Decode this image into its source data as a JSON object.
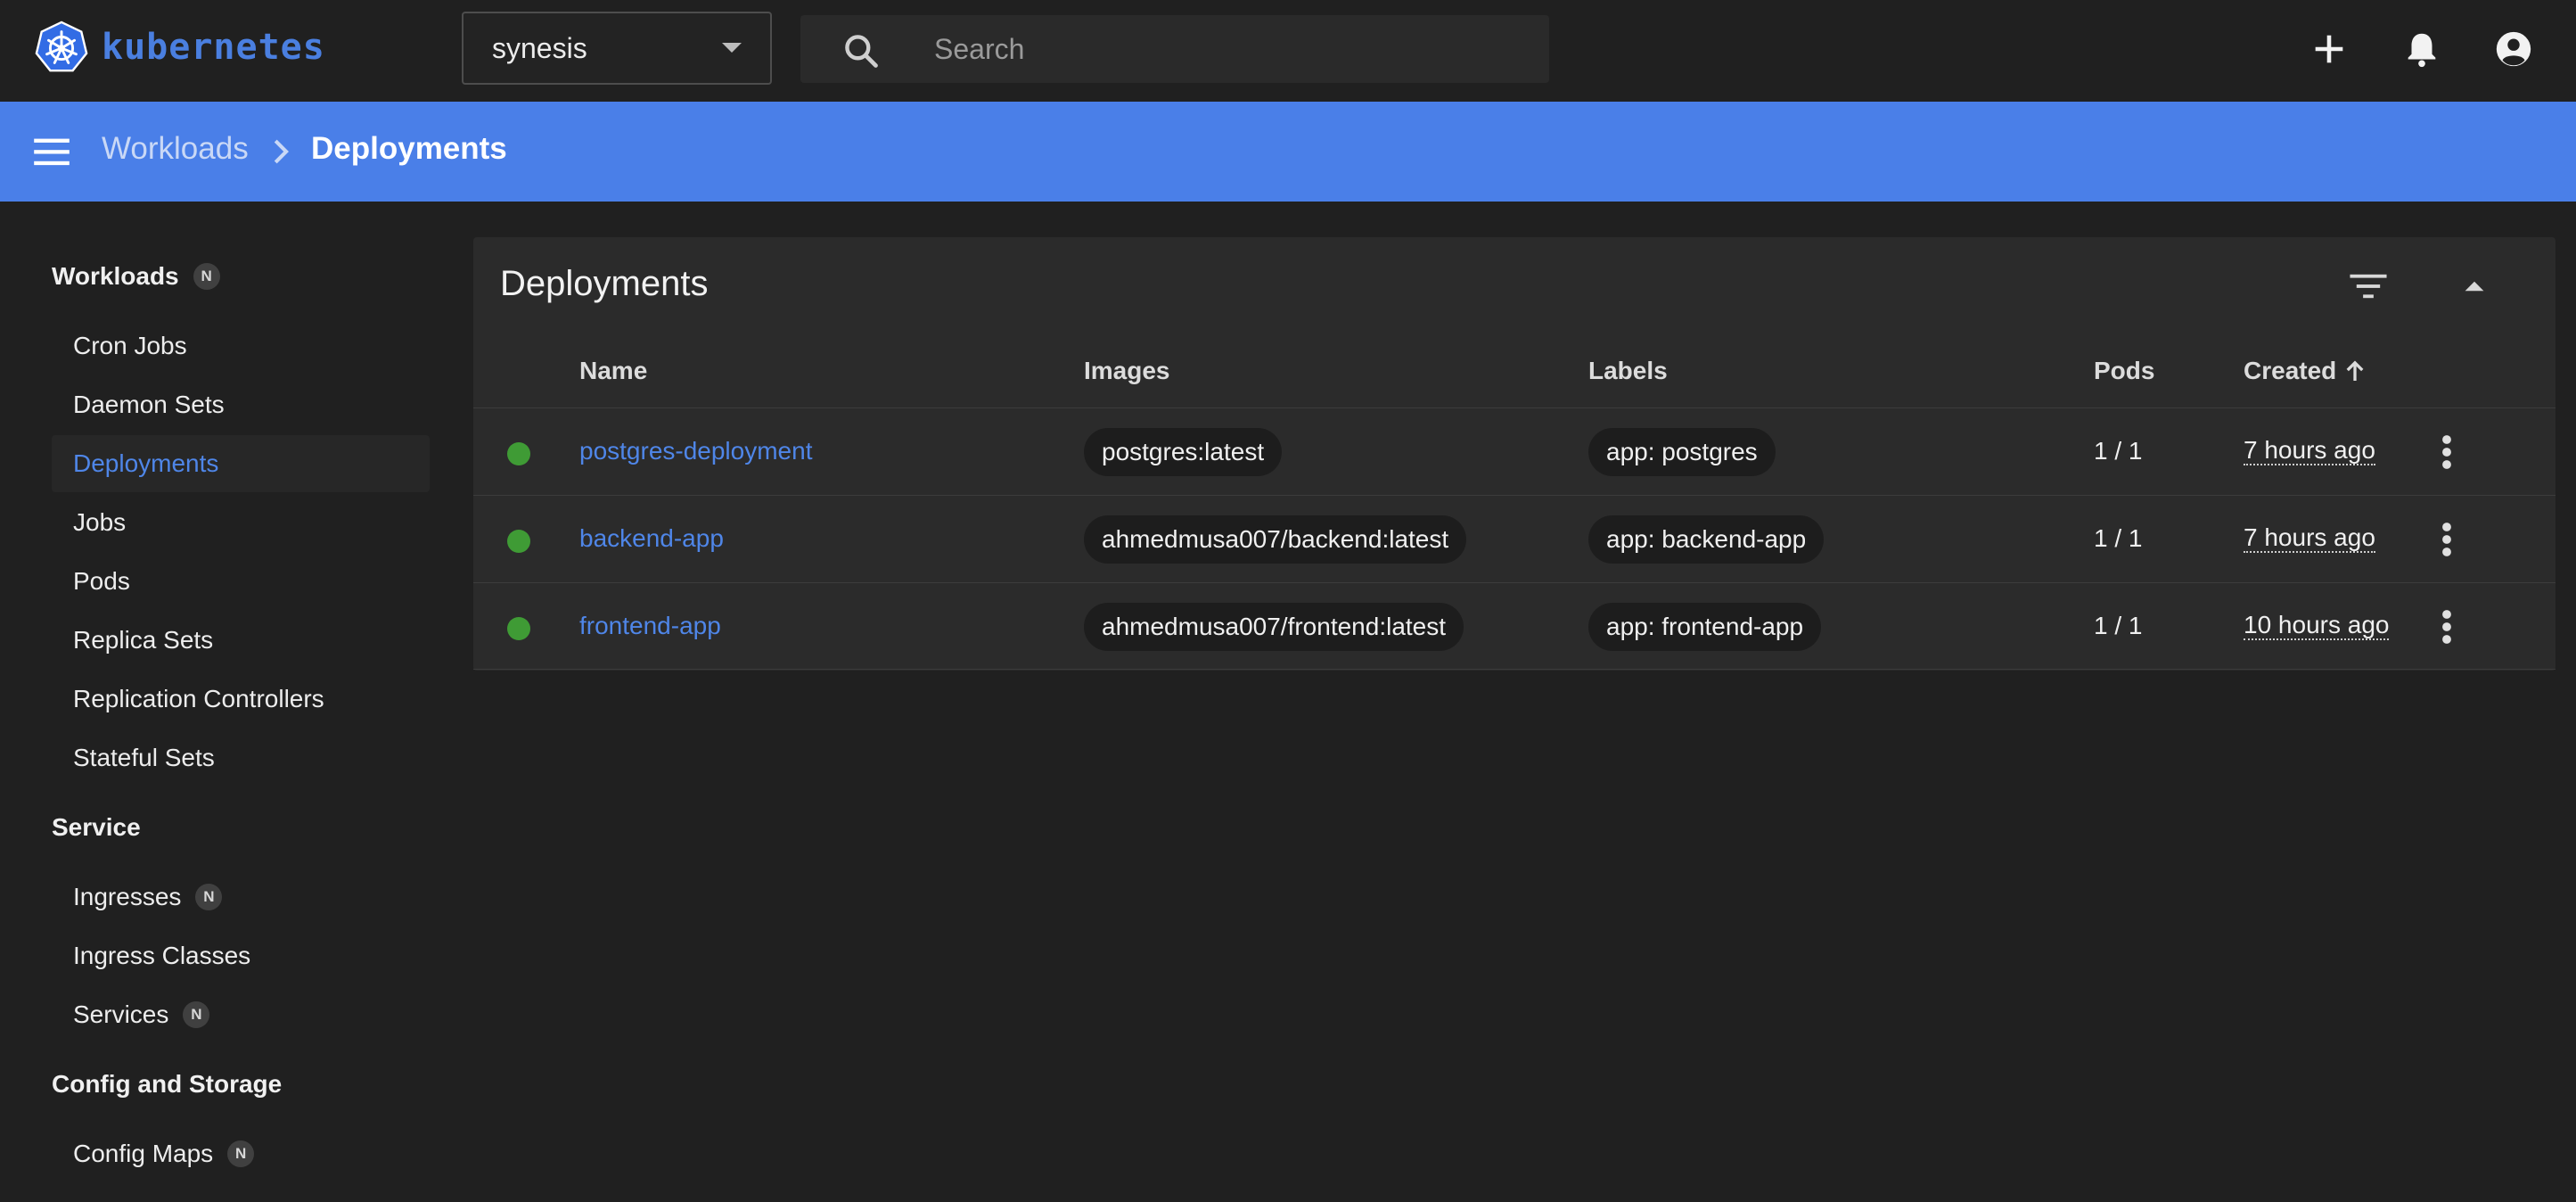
{
  "app": {
    "logo_text": "kubernetes",
    "accent_color": "#4a7fe8"
  },
  "topbar": {
    "namespace": "synesis",
    "search_placeholder": "Search",
    "icons": [
      "plus-icon",
      "bell-icon",
      "account-icon"
    ]
  },
  "breadcrumb": {
    "parent": "Workloads",
    "current": "Deployments"
  },
  "sidebar": {
    "workloads": {
      "title": "Workloads",
      "badge": "N",
      "items": [
        {
          "label": "Cron Jobs"
        },
        {
          "label": "Daemon Sets"
        },
        {
          "label": "Deployments",
          "active": true
        },
        {
          "label": "Jobs"
        },
        {
          "label": "Pods"
        },
        {
          "label": "Replica Sets"
        },
        {
          "label": "Replication Controllers"
        },
        {
          "label": "Stateful Sets"
        }
      ]
    },
    "service": {
      "title": "Service",
      "items": [
        {
          "label": "Ingresses",
          "badge": "N"
        },
        {
          "label": "Ingress Classes"
        },
        {
          "label": "Services",
          "badge": "N"
        }
      ]
    },
    "config": {
      "title": "Config and Storage",
      "items": [
        {
          "label": "Config Maps",
          "badge": "N"
        }
      ]
    }
  },
  "card": {
    "title": "Deployments",
    "columns": {
      "name": "Name",
      "images": "Images",
      "labels": "Labels",
      "pods": "Pods",
      "created": "Created"
    },
    "rows": [
      {
        "status": "running",
        "name": "postgres-deployment",
        "image": "postgres:latest",
        "label": "app: postgres",
        "pods": "1 / 1",
        "created": "7 hours ago"
      },
      {
        "status": "running",
        "name": "backend-app",
        "image": "ahmedmusa007/backend:latest",
        "label": "app: backend-app",
        "pods": "1 / 1",
        "created": "7 hours ago"
      },
      {
        "status": "running",
        "name": "frontend-app",
        "image": "ahmedmusa007/frontend:latest",
        "label": "app: frontend-app",
        "pods": "1 / 1",
        "created": "10 hours ago"
      }
    ]
  }
}
